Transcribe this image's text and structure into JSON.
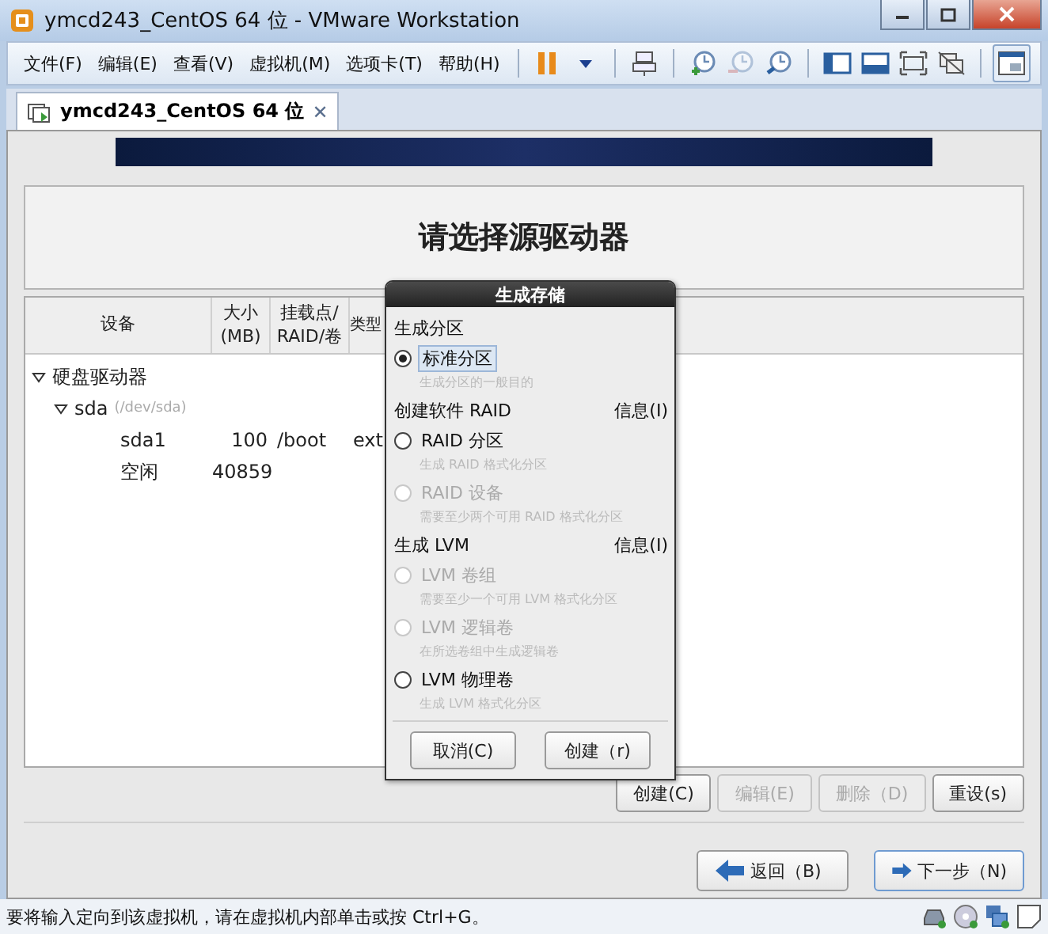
{
  "window": {
    "title": "ymcd243_CentOS 64 位 - VMware Workstation"
  },
  "menu": [
    "文件(F)",
    "编辑(E)",
    "查看(V)",
    "虚拟机(M)",
    "选项卡(T)",
    "帮助(H)"
  ],
  "tabs": [
    {
      "label": "ymcd243_CentOS 64 位",
      "close": "✕",
      "selected": true
    }
  ],
  "header": {
    "title": "请选择源驱动器"
  },
  "table": {
    "columns": [
      "设备",
      "大小\n(MB)",
      "挂载点/\nRAID/卷",
      "类型"
    ],
    "rows": [
      {
        "device": "硬盘驱动器",
        "expanded": true,
        "children": [
          {
            "device": "sda",
            "path": "(/dev/sda)",
            "expanded": true,
            "children": [
              {
                "device": "sda1",
                "size": "100",
                "mount": "/boot",
                "type": "ext"
              },
              {
                "device": "空闲",
                "size": "40859"
              }
            ]
          }
        ]
      }
    ]
  },
  "actions": [
    {
      "label": "创建(C)",
      "disabled": false
    },
    {
      "label": "编辑(E)",
      "disabled": true
    },
    {
      "label": "删除（D)",
      "disabled": true
    },
    {
      "label": "重设(s)",
      "disabled": false
    }
  ],
  "nav": [
    {
      "label": "返回（B)",
      "kind": "back",
      "focused": false
    },
    {
      "label": "下一步（N)",
      "kind": "next",
      "focused": true
    }
  ],
  "dialog": {
    "title": "生成存储",
    "sections": [
      {
        "title": "生成分区",
        "options": [
          {
            "label": "标准分区",
            "hint": "生成分区的一般目的",
            "selected": true,
            "disabled": false
          }
        ]
      },
      {
        "title": "创建软件 RAID",
        "info": "信息(I)",
        "options": [
          {
            "label": "RAID 分区",
            "hint": "生成 RAID 格式化分区",
            "selected": false,
            "disabled": false
          },
          {
            "label": "RAID 设备",
            "hint": "需要至少两个可用 RAID 格式化分区",
            "selected": false,
            "disabled": true
          }
        ]
      },
      {
        "title": "生成 LVM",
        "info": "信息(I)",
        "options": [
          {
            "label": "LVM 卷组",
            "hint": "需要至少一个可用 LVM 格式化分区",
            "selected": false,
            "disabled": true
          },
          {
            "label": "LVM 逻辑卷",
            "hint": "在所选卷组中生成逻辑卷",
            "selected": false,
            "disabled": true
          },
          {
            "label": "LVM 物理卷",
            "hint": "生成 LVM 格式化分区",
            "selected": false,
            "disabled": false
          }
        ]
      }
    ],
    "buttons": [
      "取消(C)",
      "创建（r)"
    ]
  },
  "status_bar": {
    "text": "要将输入定向到该虚拟机，请在虚拟机内部单击或按 Ctrl+G。"
  }
}
